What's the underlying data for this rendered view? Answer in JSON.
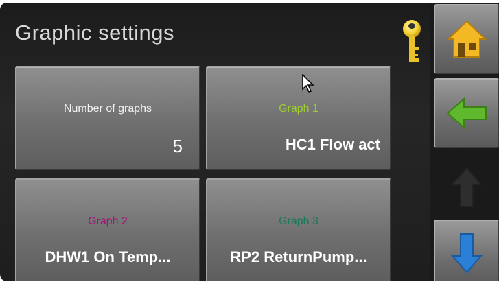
{
  "header": {
    "title": "Graphic settings"
  },
  "tiles": [
    {
      "label": "Number of graphs",
      "value": "5",
      "label_color": "#f2f2f2"
    },
    {
      "label": "Graph 1",
      "value": "HC1 Flow act",
      "label_color": "#9ccc2f"
    },
    {
      "label": "Graph 2",
      "value": "DHW1 On Temp...",
      "label_color": "#a0127a"
    },
    {
      "label": "Graph 3",
      "value": "RP2 ReturnPump...",
      "label_color": "#1a7a58"
    }
  ],
  "nav": {
    "home_icon": "home-icon",
    "back_icon": "arrow-left-icon",
    "up_icon": "arrow-up-icon",
    "down_icon": "arrow-down-icon"
  },
  "colors": {
    "home": "#f5b825",
    "back": "#5fb82d",
    "up_disabled": "#2e2e2e",
    "down": "#2a7fd6",
    "key": "#f3d235"
  }
}
